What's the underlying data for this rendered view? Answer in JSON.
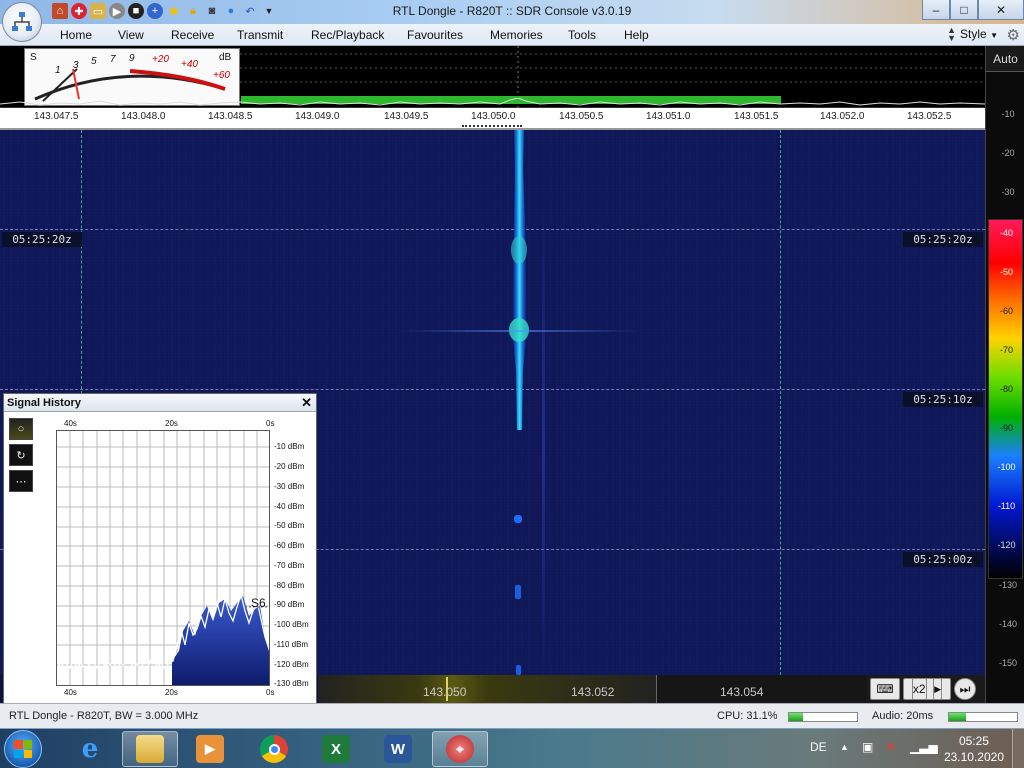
{
  "window": {
    "title": "RTL Dongle - R820T :: SDR Console v3.0.19",
    "buttons": {
      "minimize": "–",
      "maximize": "□",
      "close": "✕"
    }
  },
  "ribbon": {
    "tabs": [
      "Home",
      "View",
      "Receive",
      "Transmit",
      "Rec/Playback",
      "Favourites",
      "Memories",
      "Tools",
      "Help"
    ],
    "style_label": "Style"
  },
  "smeter": {
    "s_label": "S",
    "db_label": "dB",
    "s_marks": [
      "1",
      "3",
      "5",
      "7",
      "9"
    ],
    "db_marks": [
      "+20",
      "+40",
      "+60"
    ]
  },
  "scale": {
    "auto_label": "Auto",
    "ticks": [
      "-10",
      "-20",
      "-30",
      "-40",
      "-50",
      "-60",
      "-70",
      "-80",
      "-90",
      "-100",
      "-110",
      "-120",
      "-130",
      "-140",
      "-150"
    ]
  },
  "frequency_axis": {
    "labels": [
      "143.047.5",
      "143.048.0",
      "143.048.5",
      "143.049.0",
      "143.049.5",
      "143.050.0",
      "143.050.5",
      "143.051.0",
      "143.051.5",
      "143.052.0",
      "143.052.5"
    ]
  },
  "waterfall": {
    "timestamps": [
      "05:25:20z",
      "05:25:10z",
      "05:25:00z"
    ]
  },
  "tuning": {
    "labels": [
      "143.050",
      "143.052",
      "143.054"
    ],
    "zoom_label": "x2"
  },
  "signal_history": {
    "title": "Signal History",
    "close": "✕",
    "x_labels_top": [
      "40s",
      "20s",
      "0s"
    ],
    "x_labels_bottom": [
      "40s",
      "20s",
      "0s"
    ],
    "y_labels": [
      "-10 dBm",
      "-20 dBm",
      "-30 dBm",
      "-40 dBm",
      "-50 dBm",
      "-60 dBm",
      "-70 dBm",
      "-80 dBm",
      "-90 dBm",
      "-100 dBm",
      "-110 dBm",
      "-120 dBm",
      "-130 dBm"
    ],
    "s_reading": "S6",
    "tools": [
      "○",
      "↻",
      "⋯"
    ]
  },
  "status": {
    "device": "RTL Dongle - R820T, BW = 3.000 MHz",
    "cpu": "CPU: 31.1%",
    "cpu_level": 0.2,
    "audio": "Audio: 20ms",
    "audio_level": 0.25
  },
  "taskbar": {
    "language": "DE",
    "time": "05:25",
    "date": "23.10.2020"
  },
  "colors": {
    "waterfall_bg": "#0e1650",
    "signal": "#1a9cff",
    "spectrum_green": "#2eb82e",
    "grid_green": "#47d87a"
  }
}
